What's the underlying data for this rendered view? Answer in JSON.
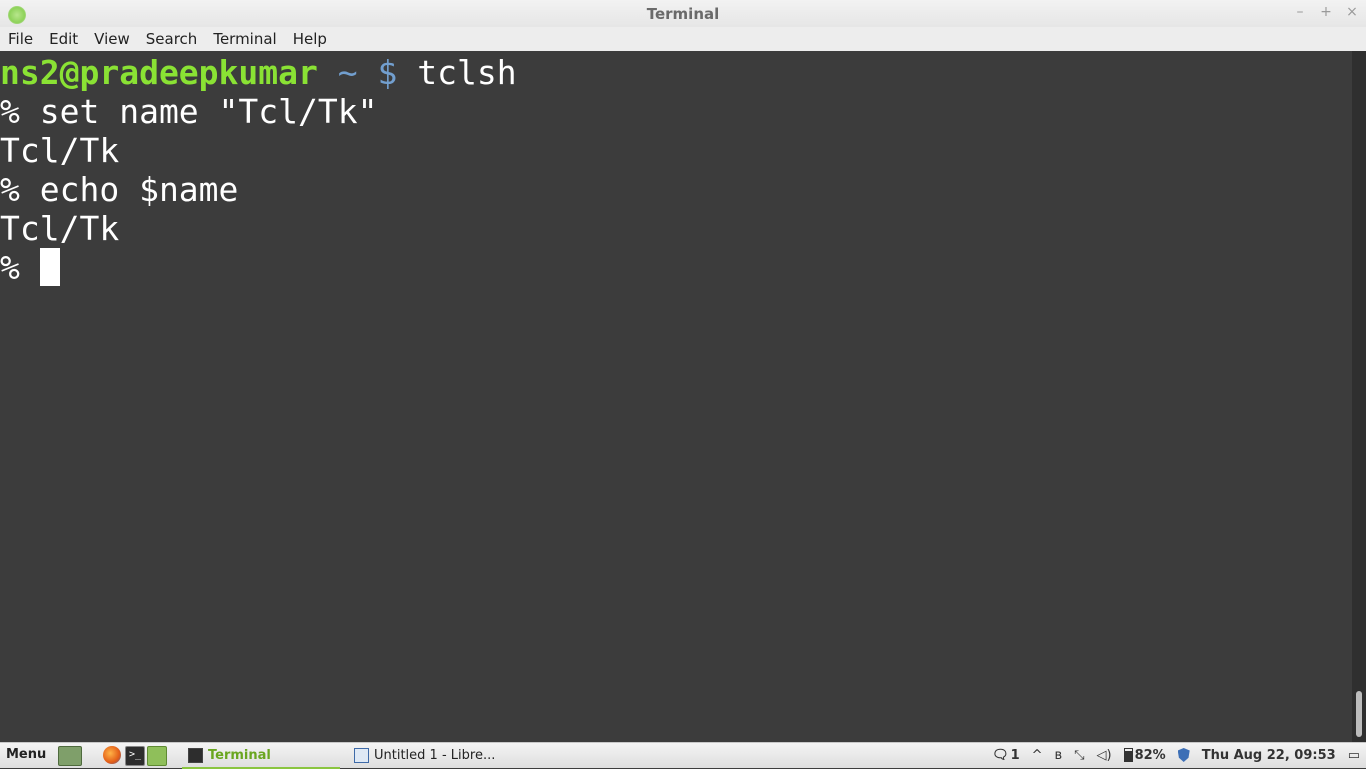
{
  "window": {
    "title": "Terminal",
    "controls": {
      "minimize": "–",
      "maximize": "+",
      "close": "×"
    }
  },
  "menubar": {
    "items": [
      "File",
      "Edit",
      "View",
      "Search",
      "Terminal",
      "Help"
    ]
  },
  "terminal": {
    "prompt_user": "ns2@pradeepkumar",
    "prompt_path": " ~ ",
    "prompt_symbol": "$",
    "first_command": " tclsh",
    "lines": [
      "% set name \"Tcl/Tk\"",
      "Tcl/Tk",
      "% echo $name",
      "Tcl/Tk"
    ],
    "current_prompt": "% "
  },
  "taskbar": {
    "menu_label": "Menu",
    "terminal_launcher_glyph": ">_",
    "tasks": [
      {
        "label": "Terminal",
        "icon": "terminal-icon",
        "active": true
      },
      {
        "label": "Untitled 1 - Libre...",
        "icon": "document-icon",
        "active": false
      }
    ],
    "tray": {
      "notifications": "1",
      "up_arrow": "^",
      "bluetooth": "ʙ",
      "network": "⤡",
      "volume": "◁)",
      "battery_percent": "82%",
      "clock": "Thu Aug 22, 09:53"
    }
  },
  "colors": {
    "terminal_bg": "#3c3c3c",
    "prompt_user": "#8ae234",
    "prompt_symbol": "#729fcf",
    "text": "#ffffff",
    "active_task": "#6aa620"
  }
}
